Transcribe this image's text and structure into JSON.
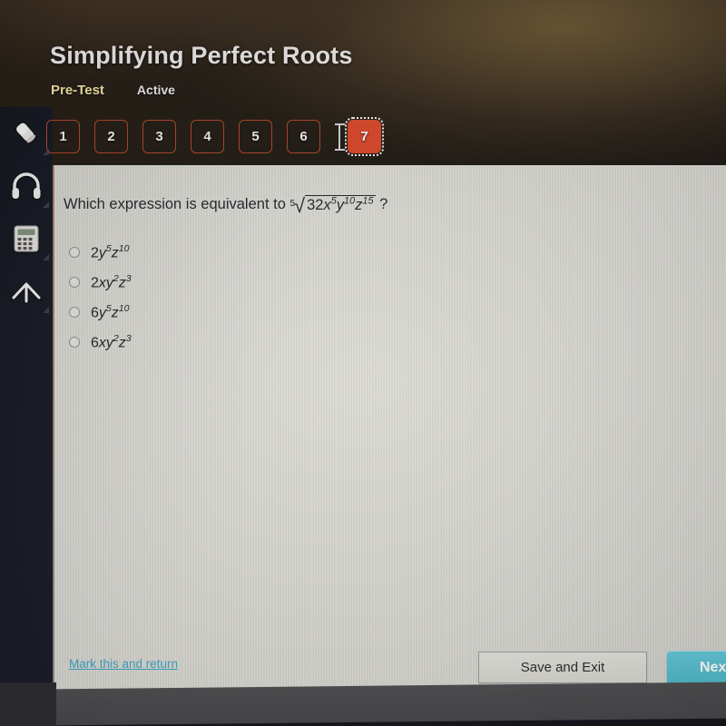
{
  "header": {
    "title": "Simplifying Perfect Roots",
    "test_label": "Pre-Test",
    "status_label": "Active"
  },
  "tabs": [
    {
      "label": "1",
      "active": false
    },
    {
      "label": "2",
      "active": false
    },
    {
      "label": "3",
      "active": false
    },
    {
      "label": "4",
      "active": false
    },
    {
      "label": "5",
      "active": false
    },
    {
      "label": "6",
      "active": false
    },
    {
      "label": "7",
      "active": true
    }
  ],
  "sidebar": {
    "items": [
      {
        "icon": "eraser-icon",
        "name": "eraser-tool"
      },
      {
        "icon": "headphones-icon",
        "name": "audio-tool"
      },
      {
        "icon": "calculator-icon",
        "name": "calculator-tool"
      },
      {
        "icon": "arrow-up-icon",
        "name": "scroll-up-tool"
      }
    ]
  },
  "question": {
    "prompt_prefix": "Which expression is equivalent to",
    "radical_index": "5",
    "radical_sign": "√",
    "radicand_parts": [
      {
        "base": "32",
        "exp": "",
        "italic": false
      },
      {
        "base": "x",
        "exp": "5",
        "italic": true
      },
      {
        "base": "y",
        "exp": "10",
        "italic": true
      },
      {
        "base": "z",
        "exp": "15",
        "italic": true
      }
    ],
    "prompt_suffix": "?"
  },
  "options": [
    {
      "id": "a",
      "parts": [
        {
          "base": "2",
          "exp": "",
          "italic": false
        },
        {
          "base": "y",
          "exp": "5",
          "italic": true
        },
        {
          "base": "z",
          "exp": "10",
          "italic": true
        }
      ],
      "selected": false
    },
    {
      "id": "b",
      "parts": [
        {
          "base": "2",
          "exp": "",
          "italic": false
        },
        {
          "base": "x",
          "exp": "",
          "italic": true
        },
        {
          "base": "y",
          "exp": "2",
          "italic": true
        },
        {
          "base": "z",
          "exp": "3",
          "italic": true
        }
      ],
      "selected": false
    },
    {
      "id": "c",
      "parts": [
        {
          "base": "6",
          "exp": "",
          "italic": false
        },
        {
          "base": "y",
          "exp": "5",
          "italic": true
        },
        {
          "base": "z",
          "exp": "10",
          "italic": true
        }
      ],
      "selected": false
    },
    {
      "id": "d",
      "parts": [
        {
          "base": "6",
          "exp": "",
          "italic": false
        },
        {
          "base": "x",
          "exp": "",
          "italic": true
        },
        {
          "base": "y",
          "exp": "2",
          "italic": true
        },
        {
          "base": "z",
          "exp": "3",
          "italic": true
        }
      ],
      "selected": false
    }
  ],
  "footer": {
    "mark_link": "Mark this and return",
    "save_button": "Save and Exit",
    "next_button": "Next"
  },
  "colors": {
    "tab_active_bg": "#d9462a",
    "tab_border": "#b04626",
    "pre_test_text": "#f2e3a4",
    "link": "#3fa4c4",
    "next_button_bg": "#4fb8c9",
    "panel_bg": "#dcdbd5",
    "header_bg": "#201a14",
    "bottom_bar": "#4a4a4c"
  }
}
